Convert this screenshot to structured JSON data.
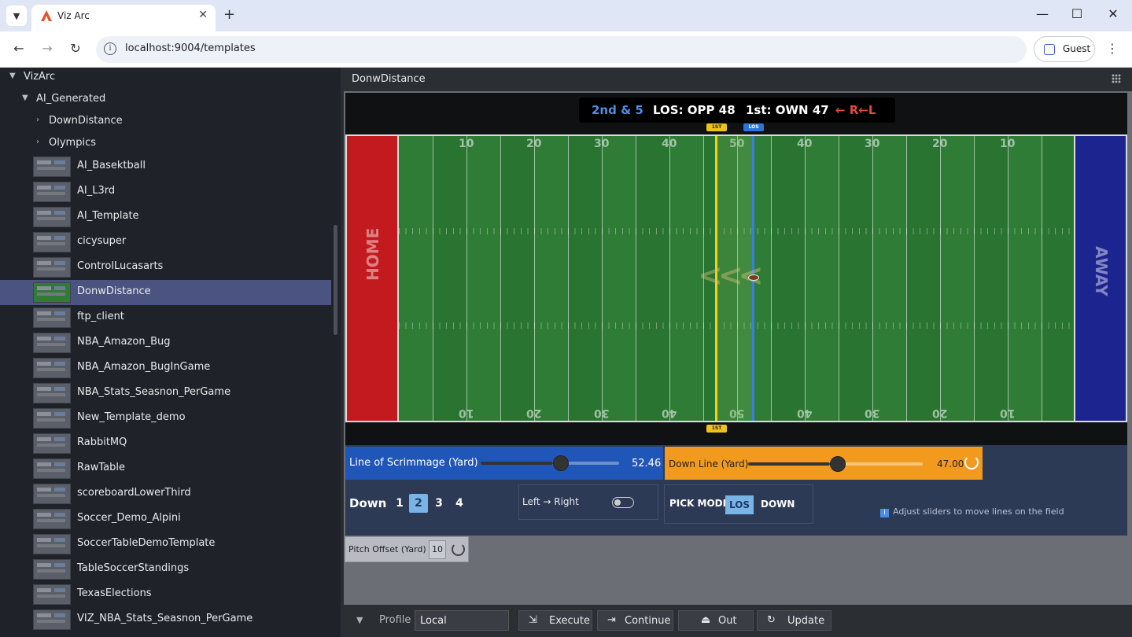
{
  "browser": {
    "tab_title": "Viz Arc",
    "url": "localhost:9004/templates",
    "profile": "Guest"
  },
  "sidebar": {
    "root": "VizArc",
    "folder": "AI_Generated",
    "subfolders": [
      "DownDistance",
      "Olympics"
    ],
    "templates": [
      "AI_Basektball",
      "AI_L3rd",
      "AI_Template",
      "cicysuper",
      "ControlLucasarts",
      "DonwDistance",
      "ftp_client",
      "NBA_Amazon_Bug",
      "NBA_Amazon_BugInGame",
      "NBA_Stats_Seasnon_PerGame",
      "New_Template_demo",
      "RabbitMQ",
      "RawTable",
      "scoreboardLowerThird",
      "Soccer_Demo_Alpini",
      "SoccerTableDemoTemplate",
      "TableSoccerStandings",
      "TexasElections",
      "VIZ_NBA_Stats_Seasnon_PerGame"
    ],
    "selected_index": 5
  },
  "main": {
    "title": "DonwDistance"
  },
  "scorebug": {
    "down_distance": "2nd & 5",
    "los": "LOS: OPP 48",
    "first": "1st: OWN 47",
    "direction": "← R←L"
  },
  "field": {
    "home_label": "HOME",
    "away_label": "AWAY",
    "yard_numbers": [
      "10",
      "20",
      "30",
      "40",
      "50",
      "40",
      "30",
      "20",
      "10"
    ],
    "chevrons": "<<<",
    "marker_first": "1ST",
    "marker_los": "LOS",
    "colors": {
      "home": "#c21a1e",
      "away": "#1c2490",
      "first_line": "#f1d21a",
      "los_line": "#3a7fe0"
    }
  },
  "controls": {
    "los_label": "Line of Scrimmage (Yard)",
    "los_value": "52.46",
    "los_fraction": 0.52,
    "down_line_label": "Down Line (Yard)",
    "down_line_value": "47.00",
    "down_line_fraction": 0.47,
    "down_label": "Down",
    "downs": [
      "1",
      "2",
      "3",
      "4"
    ],
    "active_down": 1,
    "direction_label": "Left → Right",
    "pick_mode_label": "PICK MODE",
    "pick_los": "LOS",
    "pick_down": "DOWN",
    "hint": "Adjust sliders to move lines on the field",
    "pitch_offset_label": "Pitch Offset (Yard)",
    "pitch_offset_value": "10"
  },
  "bottombar": {
    "profile_label": "Profile",
    "profile_value": "Local",
    "execute": "Execute",
    "continue": "Continue",
    "out": "Out",
    "update": "Update"
  }
}
